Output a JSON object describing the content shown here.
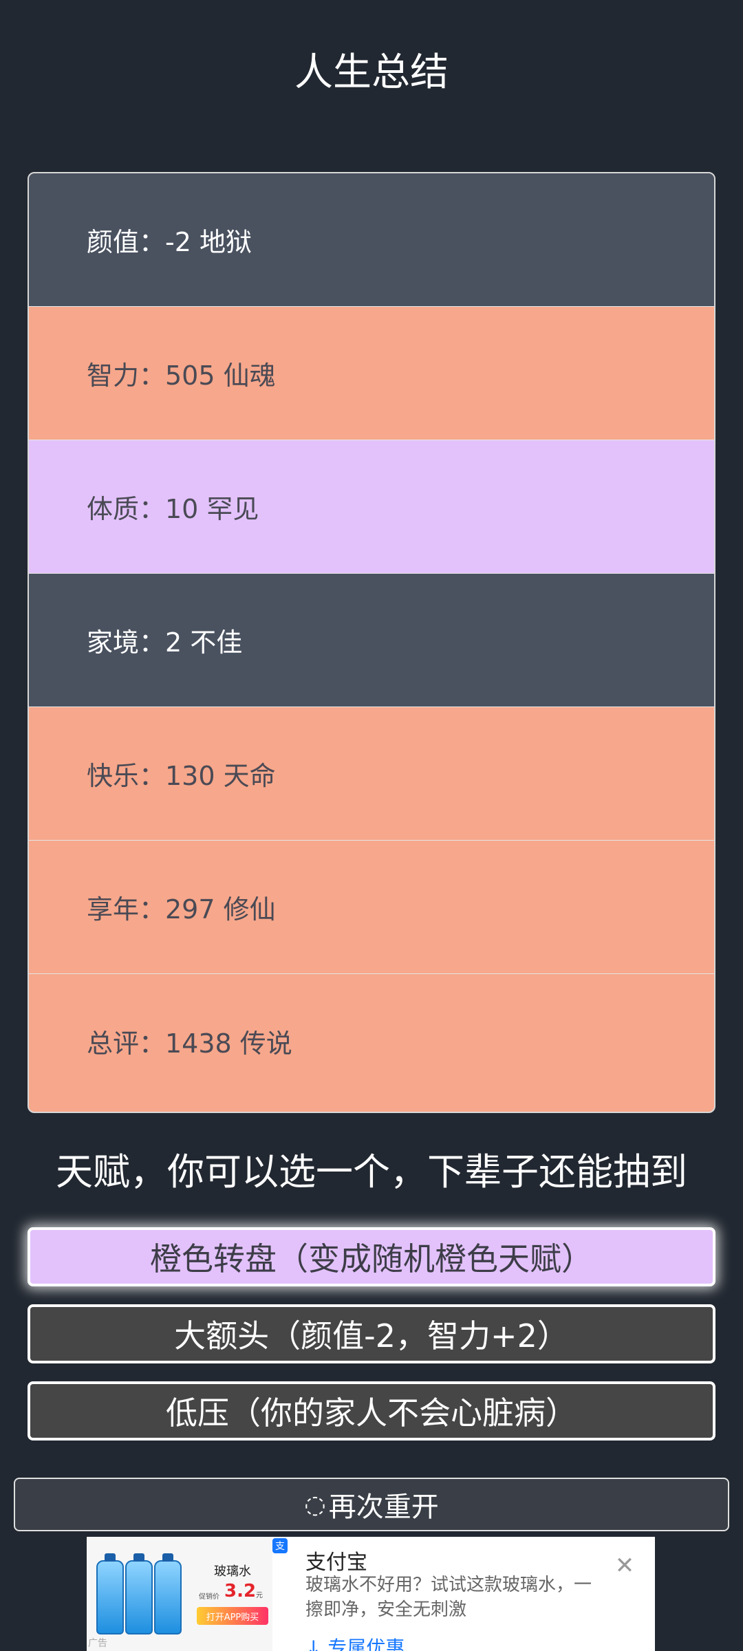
{
  "title": "人生总结",
  "summary": [
    {
      "text": "颜值：-2 地狱",
      "grade": "grey"
    },
    {
      "text": "智力：505 仙魂",
      "grade": "orange"
    },
    {
      "text": "体质：10 罕见",
      "grade": "purple"
    },
    {
      "text": "家境：2 不佳",
      "grade": "grey"
    },
    {
      "text": "快乐：130 天命",
      "grade": "orange"
    },
    {
      "text": "享年：297 修仙",
      "grade": "orange"
    },
    {
      "text": "总评：1438 传说",
      "grade": "orange"
    }
  ],
  "talent_heading": "天赋，你可以选一个，下辈子还能抽到",
  "talents": [
    {
      "label": "橙色转盘（变成随机橙色天赋）",
      "selected": true
    },
    {
      "label": "大额头（颜值-2，智力+2）",
      "selected": false
    },
    {
      "label": "低压（你的家人不会心脏病）",
      "selected": false
    }
  ],
  "restart": {
    "icon": "refresh-icon",
    "label": "再次重开"
  },
  "ad": {
    "badge": "支",
    "product_name": "玻璃水",
    "price_label": "促销价",
    "price": "3.2",
    "price_unit": "元",
    "buy_label": "打开APP购买",
    "ad_label": "广告",
    "brand": "支付宝",
    "description": "玻璃水不好用？试试这款玻璃水，一擦即净，安全无刺激",
    "cta": "专属优惠",
    "close_icon": "close-icon"
  },
  "colors": {
    "background": "#222831",
    "grey_row": "#4a5260",
    "orange_row": "#f7a78b",
    "purple_row": "#e3c2fb",
    "button_dark": "#464646"
  }
}
